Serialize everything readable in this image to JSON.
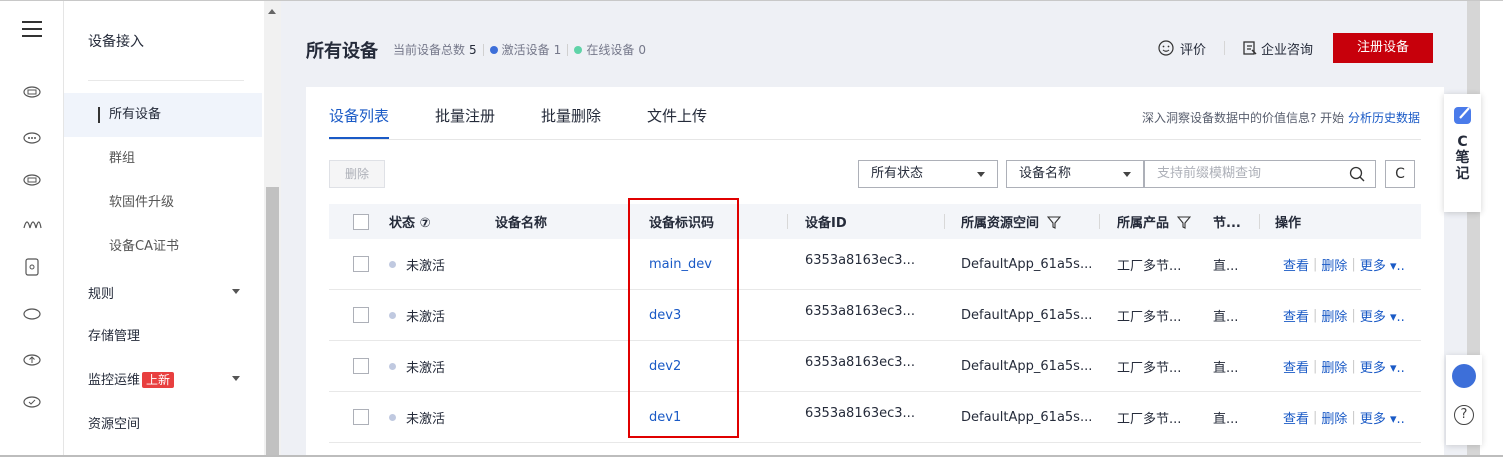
{
  "rail": {
    "icons": [
      "menu-icon",
      "cloud-icon",
      "cloud-dots-icon",
      "storage-icon",
      "waves-icon",
      "mobile-icon",
      "circle-icon",
      "cloud-up-icon",
      "cloud-check-icon"
    ]
  },
  "nav": {
    "group_title": "设备接入",
    "sub_items": [
      "所有设备",
      "群组",
      "软固件升级",
      "设备CA证书"
    ],
    "rules": "规则",
    "storage": "存储管理",
    "monitor": "监控运维",
    "monitor_badge": "上新",
    "resource": "资源空间"
  },
  "header": {
    "title": "所有设备",
    "total_label": "当前设备总数",
    "total_value": "5",
    "active_label": "激活设备",
    "active_value": "1",
    "online_label": "在线设备",
    "online_value": "0",
    "active_color": "#3d6fd9",
    "online_color": "#5fd3a8",
    "feedback": "评价",
    "consult": "企业咨询",
    "register": "注册设备"
  },
  "tabs": [
    "设备列表",
    "批量注册",
    "批量删除",
    "文件上传"
  ],
  "insight": {
    "text": "深入洞察设备数据中的价值信息? 开始",
    "link": "分析历史数据"
  },
  "toolbar": {
    "delete": "删除",
    "status_select": "所有状态",
    "field_select": "设备名称",
    "search_placeholder": "支持前缀模糊查询",
    "refresh": "C"
  },
  "table": {
    "headers": {
      "status": "状态 ⑦",
      "name": "设备名称",
      "code": "设备标识码",
      "id": "设备ID",
      "space": "所属资源空间",
      "product": "所属产品",
      "node": "节...",
      "ops": "操作"
    },
    "rows": [
      {
        "status": "未激活",
        "name": "",
        "code": "main_dev",
        "id": "6353a8163ec3...",
        "space": "DefaultApp_61a5s...",
        "product": "工厂多节...",
        "node": "直...",
        "op_view": "查看",
        "op_del": "删除",
        "op_more": "更多 ▾.."
      },
      {
        "status": "未激活",
        "name": "",
        "code": "dev3",
        "id": "6353a8163ec3...",
        "space": "DefaultApp_61a5s...",
        "product": "工厂多节...",
        "node": "直...",
        "op_view": "查看",
        "op_del": "删除",
        "op_more": "更多 ▾.."
      },
      {
        "status": "未激活",
        "name": "",
        "code": "dev2",
        "id": "6353a8163ec3...",
        "space": "DefaultApp_61a5s...",
        "product": "工厂多节...",
        "node": "直...",
        "op_view": "查看",
        "op_del": "删除",
        "op_more": "更多 ▾.."
      },
      {
        "status": "未激活",
        "name": "",
        "code": "dev1",
        "id": "6353a8163ec3...",
        "space": "DefaultApp_61a5s...",
        "product": "工厂多节...",
        "node": "直...",
        "op_view": "查看",
        "op_del": "删除",
        "op_more": "更多 ▾.."
      }
    ]
  },
  "float_note": {
    "c": "C",
    "t1": "笔",
    "t2": "记"
  },
  "help": {
    "q": "?"
  }
}
